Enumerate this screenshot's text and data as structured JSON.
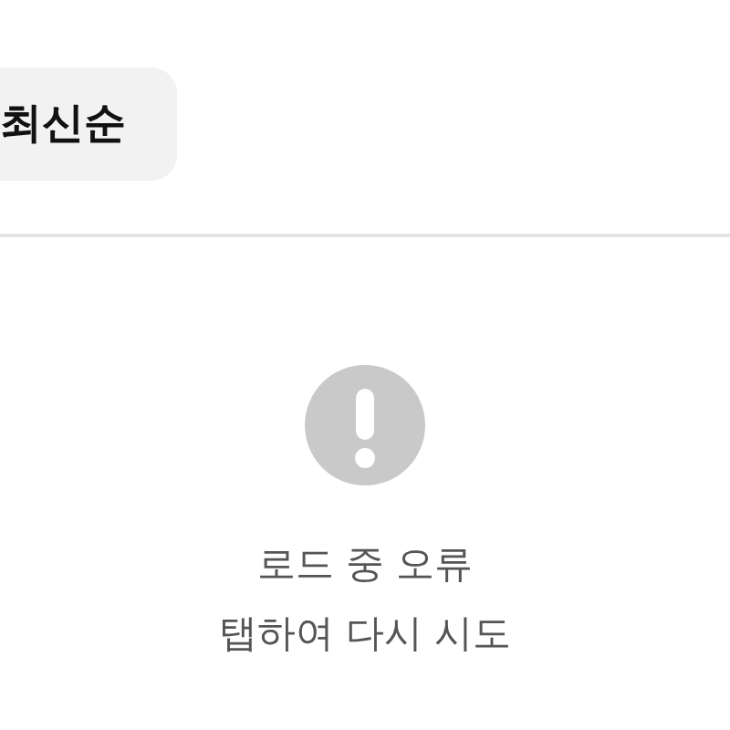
{
  "sort_button": {
    "label": "최신순"
  },
  "error": {
    "message": "로드 중 오류",
    "action": "탭하여 다시 시도"
  }
}
